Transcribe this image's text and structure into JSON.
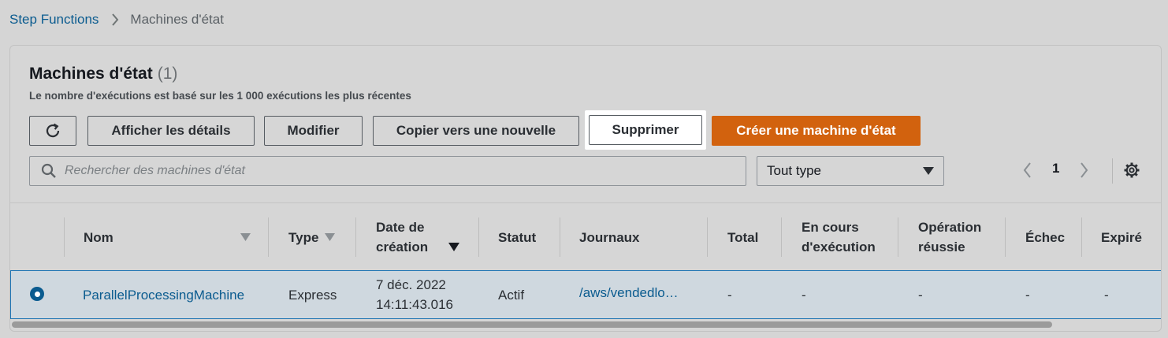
{
  "breadcrumb": {
    "root": "Step Functions",
    "current": "Machines d'état"
  },
  "panel": {
    "title": "Machines d'état",
    "count": "(1)",
    "description": "Le nombre d'exécutions est basé sur les 1 000 exécutions les plus récentes"
  },
  "toolbar": {
    "details_label": "Afficher les détails",
    "modify_label": "Modifier",
    "copy_label": "Copier vers une nouvelle",
    "delete_label": "Supprimer",
    "create_label": "Créer une machine d'état"
  },
  "search": {
    "placeholder": "Rechercher des machines d'état"
  },
  "filter": {
    "selected": "Tout type"
  },
  "pagination": {
    "current_page": "1"
  },
  "table": {
    "headers": {
      "name": "Nom",
      "type": "Type",
      "created_line1": "Date de",
      "created_line2": "création",
      "status": "Statut",
      "logs": "Journaux",
      "total": "Total",
      "running_line1": "En cours",
      "running_line2": "d'exécution",
      "succeeded_line1": "Opération",
      "succeeded_line2": "réussie",
      "failed": "Échec",
      "expired": "Expiré"
    },
    "rows": [
      {
        "name": "ParallelProcessingMachine",
        "type": "Express",
        "created_line1": "7 déc. 2022",
        "created_line2": "14:11:43.016",
        "status": "Actif",
        "logs": "/aws/vendedlo…",
        "total": "-",
        "running": "-",
        "succeeded": "-",
        "failed": "-",
        "expired": "-"
      }
    ]
  },
  "colors": {
    "link": "#0a5b8f",
    "primary_button": "#d2620e",
    "selected_row": "#cfd8df",
    "selected_border": "#1c73b3"
  },
  "icons": [
    "chevron-right-icon",
    "refresh-icon",
    "search-icon",
    "caret-down-icon",
    "chevron-left-icon",
    "settings-gear-icon",
    "sort-down-icon"
  ]
}
